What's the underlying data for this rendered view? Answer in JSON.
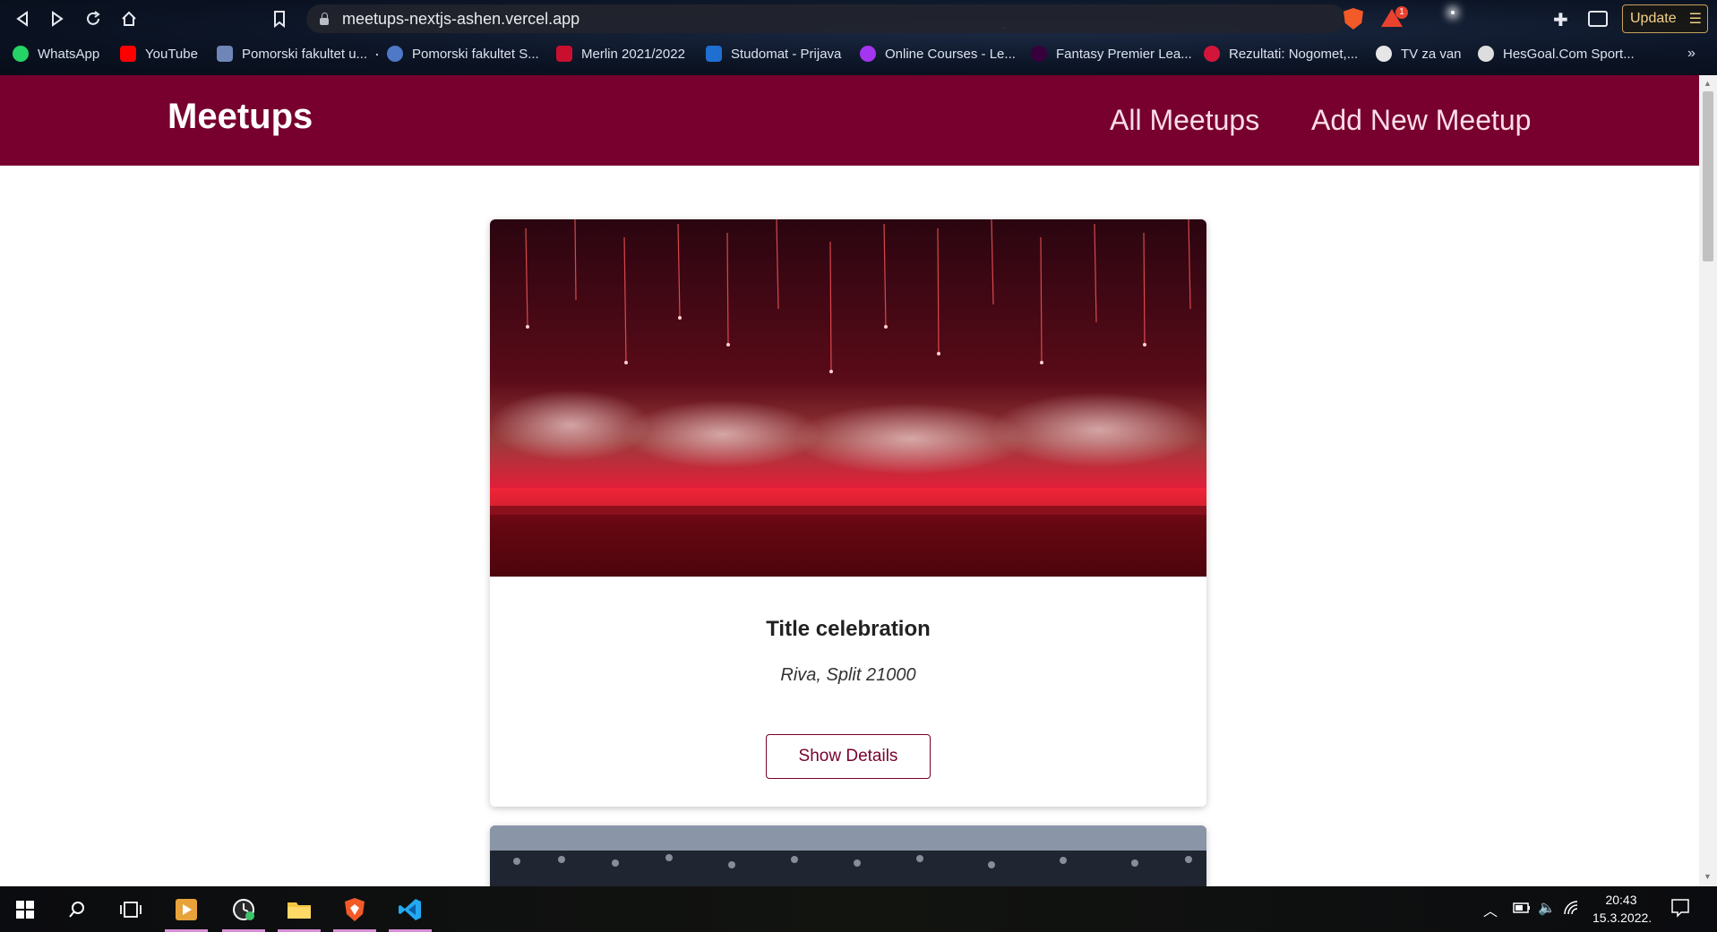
{
  "browser": {
    "url": "meetups-nextjs-ashen.vercel.app",
    "update_label": "Update",
    "shields_badge": "1",
    "bookmarks": [
      {
        "label": "WhatsApp",
        "color": "#25d366"
      },
      {
        "label": "YouTube",
        "color": "#ff0000"
      },
      {
        "label": "Pomorski fakultet u...",
        "color": "#6f87b8"
      },
      {
        "label": "Pomorski fakultet S...",
        "color": "#4d79c7"
      },
      {
        "label": "Merlin 2021/2022",
        "color": "#c8102e"
      },
      {
        "label": "Studomat - Prijava",
        "color": "#1f6fd1"
      },
      {
        "label": "Online Courses - Le...",
        "color": "#a435f0"
      },
      {
        "label": "Fantasy Premier Lea...",
        "color": "#37003c"
      },
      {
        "label": "Rezultati: Nogomet,...",
        "color": "#d3153a"
      },
      {
        "label": "TV za van",
        "color": "#e6e6e6"
      },
      {
        "label": "HesGoal.Com Sport...",
        "color": "#dddddd"
      }
    ]
  },
  "site": {
    "logo": "Meetups",
    "nav": [
      "All Meetups",
      "Add New Meetup"
    ],
    "brand_color": "#77002e"
  },
  "meetups": [
    {
      "title": "Title celebration",
      "address": "Riva, Split 21000",
      "button": "Show Details"
    }
  ],
  "taskbar": {
    "time": "20:43",
    "date": "15.3.2022."
  }
}
